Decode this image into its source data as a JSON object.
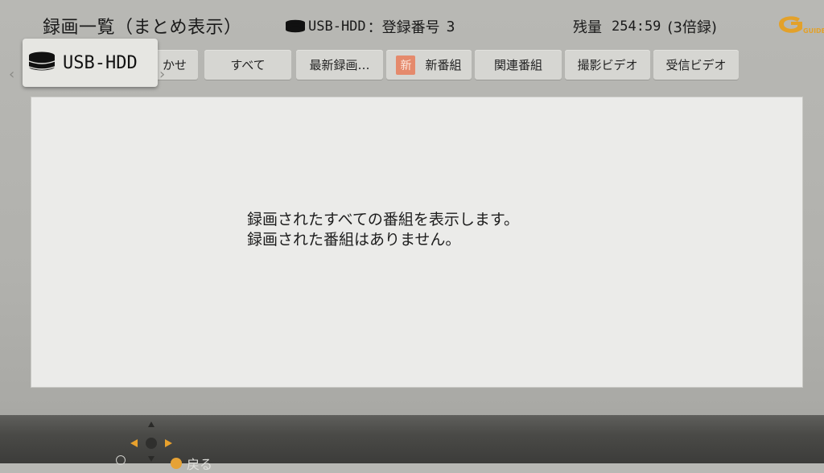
{
  "header": {
    "title": "録画一覧（まとめ表示）",
    "device_name": "USB-HDD",
    "registration_label": "：登録番号",
    "registration_number": "3",
    "remaining_label": "残量",
    "remaining_time": "254:59",
    "remaining_mode": "(3倍録)",
    "logo_text": "GUIDE",
    "logo_icon": "g-guide-logo"
  },
  "device_selector": {
    "label": "USB-HDD",
    "icon": "hdd-stack-icon"
  },
  "tabs": [
    {
      "label": "かせ"
    },
    {
      "label": "すべて"
    },
    {
      "label": "最新録画…"
    },
    {
      "label": "新番組",
      "badge": "新"
    },
    {
      "label": "関連番組"
    },
    {
      "label": "撮影ビデオ"
    },
    {
      "label": "受信ビデオ"
    }
  ],
  "nav_arrows": {
    "left": "‹",
    "right": "›"
  },
  "message": {
    "line1": "録画されたすべての番組を表示します。",
    "line2": "録画された番組はありません。"
  },
  "footer": {
    "back_label": "戻る",
    "dpad_icon": "dpad-icon"
  },
  "colors": {
    "background": "#b5b5b1",
    "panel": "#ebebe9",
    "tab": "#d6d6d2",
    "new_badge": "#e58a6c",
    "accent_orange": "#e6a235",
    "footer": "#4a4a47"
  }
}
